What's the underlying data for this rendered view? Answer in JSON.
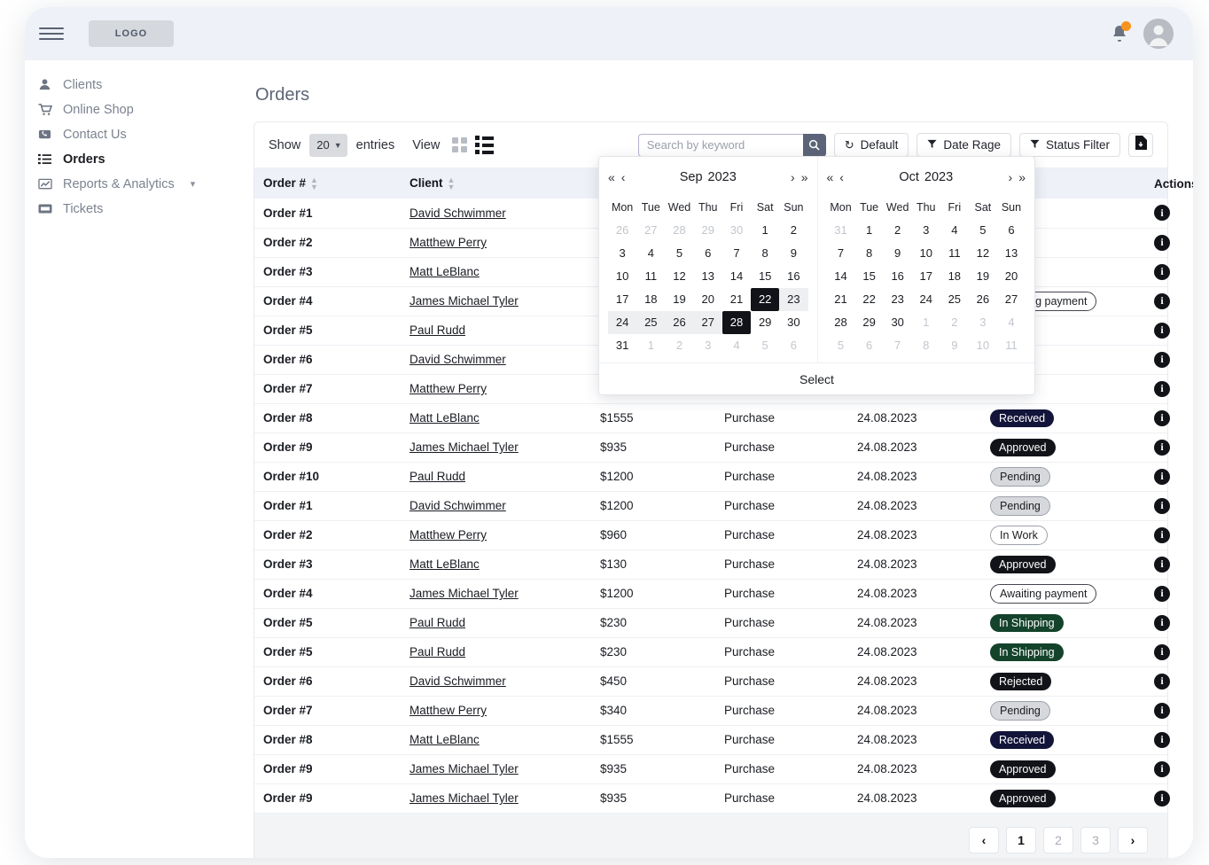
{
  "topbar": {
    "menu_icon": "hamburger-icon",
    "logo_text": "LOGO",
    "notifications_icon": "bell-icon",
    "avatar_icon": "user-avatar-icon"
  },
  "sidebar": {
    "items": [
      {
        "label": "Clients",
        "icon": "person-icon",
        "active": false,
        "chevron": ""
      },
      {
        "label": "Online Shop",
        "icon": "cart-icon",
        "active": false,
        "chevron": ""
      },
      {
        "label": "Contact Us",
        "icon": "phone-icon",
        "active": false,
        "chevron": ""
      },
      {
        "label": "Orders",
        "icon": "list-icon",
        "active": true,
        "chevron": ""
      },
      {
        "label": "Reports & Analytics",
        "icon": "chart-icon",
        "active": false,
        "chevron": "chevron-down-icon"
      },
      {
        "label": "Tickets",
        "icon": "ticket-icon",
        "active": false,
        "chevron": ""
      }
    ]
  },
  "page": {
    "title": "Orders"
  },
  "toolbar": {
    "show_label": "Show",
    "entries_value": "20",
    "entries_label": "entries",
    "view_label": "View",
    "grid_view_icon": "grid-view-icon",
    "list_view_icon": "list-view-icon",
    "search_placeholder": "Search by keyword",
    "search_value": "",
    "search_icon": "search-icon",
    "default_label": "Default",
    "default_icon": "reset-icon",
    "date_range_label": "Date Rage",
    "date_range_icon": "filter-icon",
    "status_filter_label": "Status Filter",
    "status_filter_icon": "filter-icon",
    "export_icon": "file-download-icon"
  },
  "table": {
    "columns": [
      {
        "label": "Order #",
        "sortable": true
      },
      {
        "label": "Client",
        "sortable": true
      },
      {
        "label": "",
        "sortable": false
      },
      {
        "label": "",
        "sortable": false
      },
      {
        "label": "",
        "sortable": false
      },
      {
        "label": "",
        "sortable": false
      },
      {
        "label": "Actions",
        "sortable": false
      }
    ],
    "rows": [
      {
        "order": "Order #1",
        "client": "David Schwimmer",
        "amount": "",
        "type": "",
        "date": "",
        "status": "",
        "status_class": ""
      },
      {
        "order": "Order #2",
        "client": "Matthew Perry",
        "amount": "",
        "type": "",
        "date": "",
        "status": "",
        "status_class": ""
      },
      {
        "order": "Order #3",
        "client": "Matt LeBlanc",
        "amount": "",
        "type": "",
        "date": "",
        "status": "",
        "status_class": ""
      },
      {
        "order": "Order #4",
        "client": "James Michael Tyler",
        "amount": "",
        "type": "",
        "date": "",
        "status": "Awaiting payment",
        "status_class": "b-awaiting"
      },
      {
        "order": "Order #5",
        "client": "Paul Rudd",
        "amount": "",
        "type": "",
        "date": "",
        "status": "",
        "status_class": ""
      },
      {
        "order": "Order #6",
        "client": "David Schwimmer",
        "amount": "",
        "type": "",
        "date": "",
        "status": "",
        "status_class": ""
      },
      {
        "order": "Order #7",
        "client": "Matthew Perry",
        "amount": "",
        "type": "",
        "date": "",
        "status": "",
        "status_class": ""
      },
      {
        "order": "Order #8",
        "client": "Matt LeBlanc",
        "amount": "$1555",
        "type": "Purchase",
        "date": "24.08.2023",
        "status": "Received",
        "status_class": "b-received"
      },
      {
        "order": "Order #9",
        "client": "James Michael Tyler",
        "amount": "$935",
        "type": "Purchase",
        "date": "24.08.2023",
        "status": "Approved",
        "status_class": "b-approved"
      },
      {
        "order": "Order #10",
        "client": "Paul Rudd",
        "amount": "$1200",
        "type": "Purchase",
        "date": "24.08.2023",
        "status": "Pending",
        "status_class": "b-pending"
      },
      {
        "order": "Order #1",
        "client": "David Schwimmer",
        "amount": "$1200",
        "type": "Purchase",
        "date": "24.08.2023",
        "status": "Pending",
        "status_class": "b-pending"
      },
      {
        "order": "Order #2",
        "client": "Matthew Perry",
        "amount": "$960",
        "type": "Purchase",
        "date": "24.08.2023",
        "status": "In Work",
        "status_class": "b-inwork"
      },
      {
        "order": "Order #3",
        "client": "Matt LeBlanc",
        "amount": "$130",
        "type": "Purchase",
        "date": "24.08.2023",
        "status": "Approved",
        "status_class": "b-approved"
      },
      {
        "order": "Order #4",
        "client": "James Michael Tyler",
        "amount": "$1200",
        "type": "Purchase",
        "date": "24.08.2023",
        "status": "Awaiting payment",
        "status_class": "b-awaiting"
      },
      {
        "order": "Order #5",
        "client": "Paul Rudd",
        "amount": "$230",
        "type": "Purchase",
        "date": "24.08.2023",
        "status": "In Shipping",
        "status_class": "b-shipping"
      },
      {
        "order": "Order #5",
        "client": "Paul Rudd",
        "amount": "$230",
        "type": "Purchase",
        "date": "24.08.2023",
        "status": "In Shipping",
        "status_class": "b-shipping"
      },
      {
        "order": "Order #6",
        "client": "David Schwimmer",
        "amount": "$450",
        "type": "Purchase",
        "date": "24.08.2023",
        "status": "Rejected",
        "status_class": "b-rejected"
      },
      {
        "order": "Order #7",
        "client": "Matthew Perry",
        "amount": "$340",
        "type": "Purchase",
        "date": "24.08.2023",
        "status": "Pending",
        "status_class": "b-pending"
      },
      {
        "order": "Order #8",
        "client": "Matt LeBlanc",
        "amount": "$1555",
        "type": "Purchase",
        "date": "24.08.2023",
        "status": "Received",
        "status_class": "b-received"
      },
      {
        "order": "Order #9",
        "client": "James Michael Tyler",
        "amount": "$935",
        "type": "Purchase",
        "date": "24.08.2023",
        "status": "Approved",
        "status_class": "b-approved"
      },
      {
        "order": "Order #9",
        "client": "James Michael Tyler",
        "amount": "$935",
        "type": "Purchase",
        "date": "24.08.2023",
        "status": "Approved",
        "status_class": "b-approved"
      }
    ],
    "action_icon": "info-icon"
  },
  "pagination": {
    "prev_icon": "chevron-left-icon",
    "next_icon": "chevron-right-icon",
    "pages": [
      "1",
      "2",
      "3"
    ],
    "current": "1"
  },
  "calendar": {
    "select_label": "Select",
    "dow": [
      "Mon",
      "Tue",
      "Wed",
      "Thu",
      "Fri",
      "Sat",
      "Sun"
    ],
    "months": [
      {
        "month": "Sep",
        "year": "2023",
        "prev_year_icon": "double-chevron-left-icon",
        "prev_month_icon": "chevron-left-icon",
        "next_month_icon": "chevron-right-icon",
        "next_year_icon": "double-chevron-right-icon",
        "days": [
          {
            "d": "26",
            "s": "mut"
          },
          {
            "d": "27",
            "s": "mut"
          },
          {
            "d": "28",
            "s": "mut"
          },
          {
            "d": "29",
            "s": "mut"
          },
          {
            "d": "30",
            "s": "mut"
          },
          {
            "d": "1",
            "s": ""
          },
          {
            "d": "2",
            "s": ""
          },
          {
            "d": "3",
            "s": ""
          },
          {
            "d": "4",
            "s": ""
          },
          {
            "d": "5",
            "s": ""
          },
          {
            "d": "6",
            "s": ""
          },
          {
            "d": "7",
            "s": ""
          },
          {
            "d": "8",
            "s": ""
          },
          {
            "d": "9",
            "s": ""
          },
          {
            "d": "10",
            "s": ""
          },
          {
            "d": "11",
            "s": ""
          },
          {
            "d": "12",
            "s": ""
          },
          {
            "d": "13",
            "s": ""
          },
          {
            "d": "14",
            "s": ""
          },
          {
            "d": "15",
            "s": ""
          },
          {
            "d": "16",
            "s": ""
          },
          {
            "d": "17",
            "s": ""
          },
          {
            "d": "18",
            "s": ""
          },
          {
            "d": "19",
            "s": ""
          },
          {
            "d": "20",
            "s": ""
          },
          {
            "d": "21",
            "s": ""
          },
          {
            "d": "22",
            "s": "sel"
          },
          {
            "d": "23",
            "s": "rng"
          },
          {
            "d": "24",
            "s": "rng"
          },
          {
            "d": "25",
            "s": "rng"
          },
          {
            "d": "26",
            "s": "rng"
          },
          {
            "d": "27",
            "s": "rng"
          },
          {
            "d": "28",
            "s": "sel"
          },
          {
            "d": "29",
            "s": ""
          },
          {
            "d": "30",
            "s": ""
          },
          {
            "d": "31",
            "s": ""
          },
          {
            "d": "1",
            "s": "mut"
          },
          {
            "d": "2",
            "s": "mut"
          },
          {
            "d": "3",
            "s": "mut"
          },
          {
            "d": "4",
            "s": "mut"
          },
          {
            "d": "5",
            "s": "mut"
          },
          {
            "d": "6",
            "s": "mut"
          }
        ]
      },
      {
        "month": "Oct",
        "year": "2023",
        "prev_year_icon": "double-chevron-left-icon",
        "prev_month_icon": "chevron-left-icon",
        "next_month_icon": "chevron-right-icon",
        "next_year_icon": "double-chevron-right-icon",
        "days": [
          {
            "d": "31",
            "s": "mut"
          },
          {
            "d": "1",
            "s": ""
          },
          {
            "d": "2",
            "s": ""
          },
          {
            "d": "3",
            "s": ""
          },
          {
            "d": "4",
            "s": ""
          },
          {
            "d": "5",
            "s": ""
          },
          {
            "d": "6",
            "s": ""
          },
          {
            "d": "7",
            "s": ""
          },
          {
            "d": "8",
            "s": ""
          },
          {
            "d": "9",
            "s": ""
          },
          {
            "d": "10",
            "s": ""
          },
          {
            "d": "11",
            "s": ""
          },
          {
            "d": "12",
            "s": ""
          },
          {
            "d": "13",
            "s": ""
          },
          {
            "d": "14",
            "s": ""
          },
          {
            "d": "15",
            "s": ""
          },
          {
            "d": "16",
            "s": ""
          },
          {
            "d": "17",
            "s": ""
          },
          {
            "d": "18",
            "s": ""
          },
          {
            "d": "19",
            "s": ""
          },
          {
            "d": "20",
            "s": ""
          },
          {
            "d": "21",
            "s": ""
          },
          {
            "d": "22",
            "s": ""
          },
          {
            "d": "23",
            "s": ""
          },
          {
            "d": "24",
            "s": ""
          },
          {
            "d": "25",
            "s": ""
          },
          {
            "d": "26",
            "s": ""
          },
          {
            "d": "27",
            "s": ""
          },
          {
            "d": "28",
            "s": ""
          },
          {
            "d": "29",
            "s": ""
          },
          {
            "d": "30",
            "s": ""
          },
          {
            "d": "1",
            "s": "mut"
          },
          {
            "d": "2",
            "s": "mut"
          },
          {
            "d": "3",
            "s": "mut"
          },
          {
            "d": "4",
            "s": "mut"
          },
          {
            "d": "5",
            "s": "mut"
          },
          {
            "d": "6",
            "s": "mut"
          },
          {
            "d": "7",
            "s": "mut"
          },
          {
            "d": "8",
            "s": "mut"
          },
          {
            "d": "9",
            "s": "mut"
          },
          {
            "d": "10",
            "s": "mut"
          },
          {
            "d": "11",
            "s": "mut"
          }
        ]
      }
    ]
  }
}
